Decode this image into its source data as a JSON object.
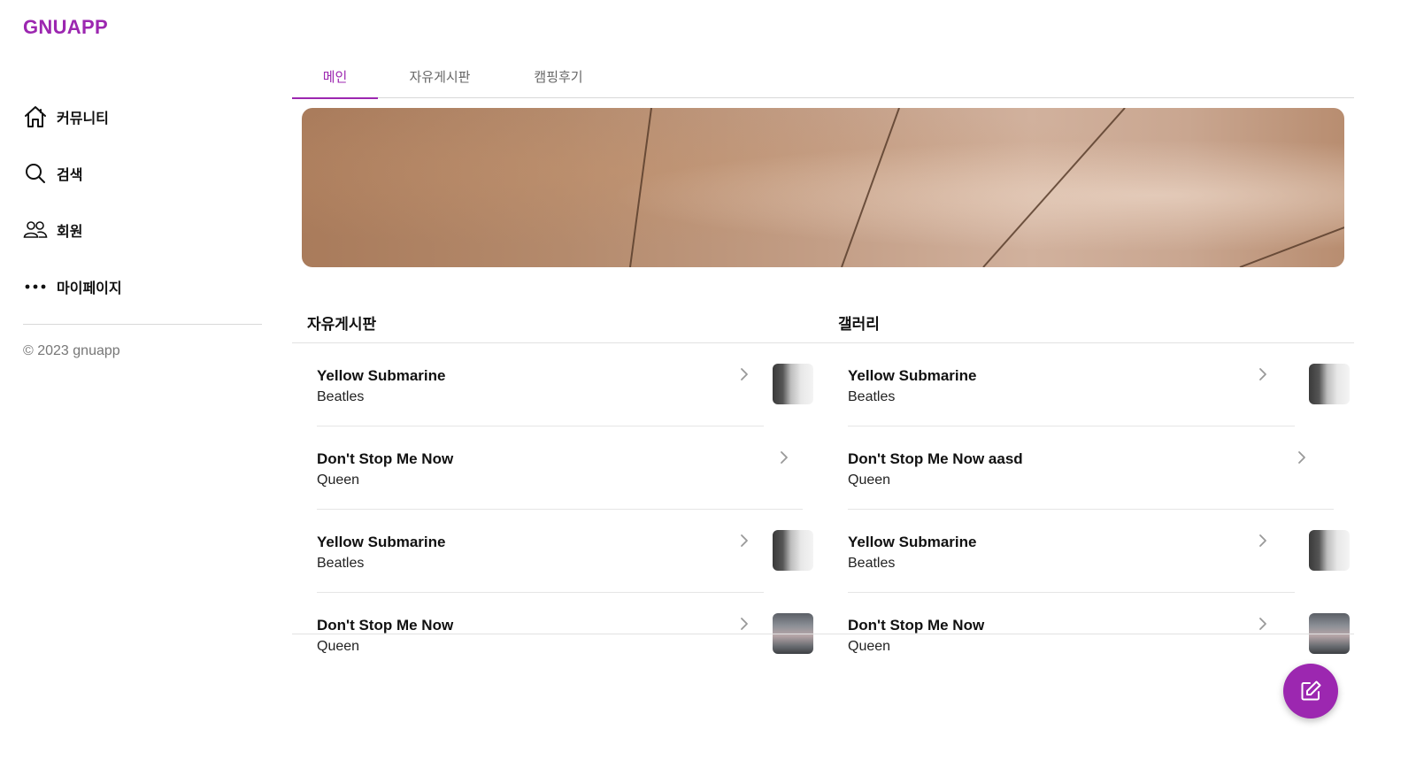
{
  "app": {
    "logo": "GNUAPP",
    "accent": "#9c27b0"
  },
  "sidebar": {
    "items": [
      {
        "label": "커뮤니티",
        "icon": "home-icon"
      },
      {
        "label": "검색",
        "icon": "search-icon"
      },
      {
        "label": "회원",
        "icon": "users-icon"
      },
      {
        "label": "마이페이지",
        "icon": "more-icon"
      }
    ],
    "copyright": "© 2023 gnuapp"
  },
  "tabs": [
    {
      "label": "메인",
      "active": true
    },
    {
      "label": "자유게시판",
      "active": false
    },
    {
      "label": "캠핑후기",
      "active": false
    }
  ],
  "sections": [
    {
      "title": "자유게시판",
      "items": [
        {
          "title": "Yellow Submarine",
          "subtitle": "Beatles",
          "thumb": "face"
        },
        {
          "title": "Don't Stop Me Now",
          "subtitle": "Queen",
          "thumb": "none"
        },
        {
          "title": "Yellow Submarine",
          "subtitle": "Beatles",
          "thumb": "face"
        },
        {
          "title": "Don't Stop Me Now",
          "subtitle": "Queen",
          "thumb": "street"
        }
      ]
    },
    {
      "title": "갤러리",
      "items": [
        {
          "title": "Yellow Submarine",
          "subtitle": "Beatles",
          "thumb": "face"
        },
        {
          "title": "Don't Stop Me Now aasd",
          "subtitle": "Queen",
          "thumb": "none"
        },
        {
          "title": "Yellow Submarine",
          "subtitle": "Beatles",
          "thumb": "face"
        },
        {
          "title": "Don't Stop Me Now",
          "subtitle": "Queen",
          "thumb": "street"
        }
      ]
    }
  ],
  "fab": {
    "icon": "edit-icon"
  }
}
